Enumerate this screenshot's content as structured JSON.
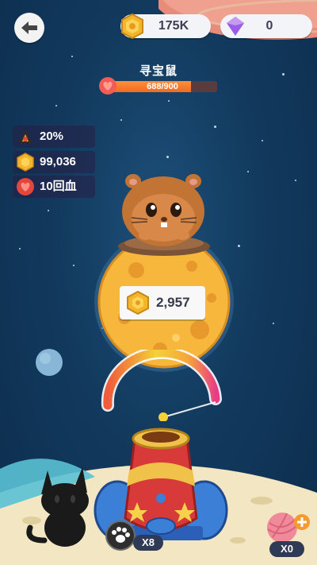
{
  "header": {
    "back_icon": "back-arrow-icon",
    "gold": {
      "icon": "gold-coin-icon",
      "value": "175K"
    },
    "gems": {
      "icon": "purple-gem-icon",
      "value": "0"
    }
  },
  "boss": {
    "name": "寻宝鼠",
    "hp_text": "688/900",
    "hp_current": 688,
    "hp_max": 900,
    "hp_icon": "heart-icon"
  },
  "stats": [
    {
      "icon": "cannon-power-icon",
      "value": "20%"
    },
    {
      "icon": "gold-coin-icon",
      "value": "99,036"
    },
    {
      "icon": "heart-icon",
      "value": "10回血"
    }
  ],
  "moon_reward": {
    "icon": "gold-coin-icon",
    "value": "2,957"
  },
  "launcher": {
    "ammo_icon": "paw-ball-icon",
    "ammo_count": "X8"
  },
  "yarn": {
    "icon": "yarn-ball-icon",
    "count": "X0",
    "add_icon": "plus-icon"
  },
  "colors": {
    "accent_gold": "#f2b62a",
    "hp_fill": "#f47a2c",
    "space_blue": "#143e63",
    "moon": "#f5b43b"
  }
}
